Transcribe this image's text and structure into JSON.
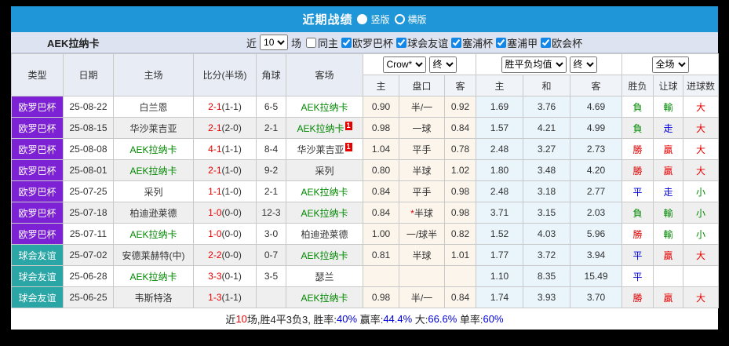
{
  "titlebar": {
    "title": "近期战绩",
    "options": [
      {
        "label": "竖版",
        "selected": true
      },
      {
        "label": "横版",
        "selected": false
      }
    ]
  },
  "filterbar": {
    "team": "AEK拉纳卡",
    "near_label": "近",
    "count_value": "10",
    "games_label": "场",
    "same_home_label": "同主",
    "same_home_checked": false,
    "leagues": [
      {
        "label": "欧罗巴杯",
        "checked": true
      },
      {
        "label": "球会友谊",
        "checked": true
      },
      {
        "label": "塞浦杯",
        "checked": true
      },
      {
        "label": "塞浦甲",
        "checked": true
      },
      {
        "label": "欧会杯",
        "checked": true
      }
    ]
  },
  "table": {
    "main_headers": [
      "类型",
      "日期",
      "主场",
      "比分(半场)",
      "角球",
      "客场"
    ],
    "selects": {
      "bookmaker": "Crow*",
      "bookmaker_stage": "终",
      "avg": "胜平负均值",
      "avg_stage": "终",
      "scope": "全场"
    },
    "sub_headers": [
      "主",
      "盘口",
      "客",
      "主",
      "和",
      "客",
      "胜负",
      "让球",
      "进球数"
    ],
    "rows": [
      {
        "type": "欧罗巴杯",
        "type_class": "purple",
        "date": "25-08-22",
        "home": "白兰恩",
        "home_class": "",
        "home_card": "",
        "score": "2-1",
        "half": "(1-1)",
        "corner": "6-5",
        "away": "AEK拉纳卡",
        "away_class": "green",
        "away_card": "",
        "crow_home": "0.90",
        "handicap": "半/一",
        "crow_away": "0.92",
        "avg_home": "1.69",
        "avg_draw": "3.76",
        "avg_away": "4.69",
        "result": "負",
        "result_class": "green",
        "let": "輸",
        "let_class": "green",
        "goal": "大",
        "goal_class": "red"
      },
      {
        "type": "欧罗巴杯",
        "type_class": "purple",
        "date": "25-08-15",
        "home": "华沙莱吉亚",
        "home_class": "",
        "home_card": "",
        "score": "2-1",
        "half": "(2-0)",
        "corner": "2-1",
        "away": "AEK拉纳卡",
        "away_class": "green",
        "away_card": "1",
        "crow_home": "0.98",
        "handicap": "一球",
        "crow_away": "0.84",
        "avg_home": "1.57",
        "avg_draw": "4.21",
        "avg_away": "4.99",
        "result": "負",
        "result_class": "green",
        "let": "走",
        "let_class": "blue",
        "goal": "大",
        "goal_class": "red"
      },
      {
        "type": "欧罗巴杯",
        "type_class": "purple",
        "date": "25-08-08",
        "home": "AEK拉纳卡",
        "home_class": "green",
        "home_card": "",
        "score": "4-1",
        "half": "(1-1)",
        "corner": "8-4",
        "away": "华沙莱吉亚",
        "away_class": "",
        "away_card": "1",
        "crow_home": "1.04",
        "handicap": "平手",
        "crow_away": "0.78",
        "avg_home": "2.48",
        "avg_draw": "3.27",
        "avg_away": "2.73",
        "result": "勝",
        "result_class": "red",
        "let": "贏",
        "let_class": "red",
        "goal": "大",
        "goal_class": "red"
      },
      {
        "type": "欧罗巴杯",
        "type_class": "purple",
        "date": "25-08-01",
        "home": "AEK拉纳卡",
        "home_class": "green",
        "home_card": "",
        "score": "2-1",
        "half": "(1-0)",
        "corner": "9-2",
        "away": "采列",
        "away_class": "",
        "away_card": "",
        "crow_home": "0.80",
        "handicap": "半球",
        "crow_away": "1.02",
        "avg_home": "1.80",
        "avg_draw": "3.48",
        "avg_away": "4.20",
        "result": "勝",
        "result_class": "red",
        "let": "贏",
        "let_class": "red",
        "goal": "大",
        "goal_class": "red"
      },
      {
        "type": "欧罗巴杯",
        "type_class": "purple",
        "date": "25-07-25",
        "home": "采列",
        "home_class": "",
        "home_card": "",
        "score": "1-1",
        "half": "(1-0)",
        "corner": "2-1",
        "away": "AEK拉纳卡",
        "away_class": "green",
        "away_card": "",
        "crow_home": "0.84",
        "handicap": "平手",
        "crow_away": "0.98",
        "avg_home": "2.48",
        "avg_draw": "3.18",
        "avg_away": "2.77",
        "result": "平",
        "result_class": "blue",
        "let": "走",
        "let_class": "blue",
        "goal": "小",
        "goal_class": "green"
      },
      {
        "type": "欧罗巴杯",
        "type_class": "purple",
        "date": "25-07-18",
        "home": "柏迪逊莱德",
        "home_class": "",
        "home_card": "",
        "score": "1-0",
        "half": "(0-0)",
        "corner": "12-3",
        "away": "AEK拉纳卡",
        "away_class": "green",
        "away_card": "",
        "crow_home": "0.84",
        "handicap": "*半球",
        "crow_away": "0.98",
        "avg_home": "3.71",
        "avg_draw": "3.15",
        "avg_away": "2.03",
        "result": "負",
        "result_class": "green",
        "let": "輸",
        "let_class": "green",
        "goal": "小",
        "goal_class": "green"
      },
      {
        "type": "欧罗巴杯",
        "type_class": "purple",
        "date": "25-07-11",
        "home": "AEK拉纳卡",
        "home_class": "green",
        "home_card": "",
        "score": "1-0",
        "half": "(0-0)",
        "corner": "3-0",
        "away": "柏迪逊莱德",
        "away_class": "",
        "away_card": "",
        "crow_home": "1.00",
        "handicap": "一/球半",
        "crow_away": "0.82",
        "avg_home": "1.52",
        "avg_draw": "4.03",
        "avg_away": "5.96",
        "result": "勝",
        "result_class": "red",
        "let": "輸",
        "let_class": "green",
        "goal": "小",
        "goal_class": "green"
      },
      {
        "type": "球会友谊",
        "type_class": "teal",
        "date": "25-07-02",
        "home": "安德莱赫特(中)",
        "home_class": "",
        "home_card": "",
        "score": "2-2",
        "half": "(0-0)",
        "corner": "0-7",
        "away": "AEK拉纳卡",
        "away_class": "green",
        "away_card": "",
        "crow_home": "0.81",
        "handicap": "半球",
        "crow_away": "1.01",
        "avg_home": "1.77",
        "avg_draw": "3.72",
        "avg_away": "3.94",
        "result": "平",
        "result_class": "blue",
        "let": "贏",
        "let_class": "red",
        "goal": "大",
        "goal_class": "red"
      },
      {
        "type": "球会友谊",
        "type_class": "teal",
        "date": "25-06-28",
        "home": "AEK拉纳卡",
        "home_class": "green",
        "home_card": "",
        "score": "3-3",
        "half": "(0-1)",
        "corner": "3-5",
        "away": "瑟兰",
        "away_class": "",
        "away_card": "",
        "crow_home": "",
        "handicap": "",
        "crow_away": "",
        "avg_home": "1.10",
        "avg_draw": "8.35",
        "avg_away": "15.49",
        "result": "平",
        "result_class": "blue",
        "let": "",
        "let_class": "",
        "goal": "",
        "goal_class": ""
      },
      {
        "type": "球会友谊",
        "type_class": "teal",
        "date": "25-06-25",
        "home": "韦斯特洛",
        "home_class": "",
        "home_card": "",
        "score": "1-3",
        "half": "(1-1)",
        "corner": "",
        "away": "AEK拉纳卡",
        "away_class": "green",
        "away_card": "",
        "crow_home": "0.98",
        "handicap": "半/一",
        "crow_away": "0.84",
        "avg_home": "1.74",
        "avg_draw": "3.93",
        "avg_away": "3.70",
        "result": "勝",
        "result_class": "red",
        "let": "贏",
        "let_class": "red",
        "goal": "大",
        "goal_class": "red"
      }
    ]
  },
  "footer": {
    "segments": [
      {
        "text": "近",
        "class": ""
      },
      {
        "text": "10",
        "class": "red"
      },
      {
        "text": "场,胜4平3负3, 胜率:",
        "class": ""
      },
      {
        "text": "40%",
        "class": "blue"
      },
      {
        "text": " 赢率:",
        "class": ""
      },
      {
        "text": "44.4%",
        "class": "blue"
      },
      {
        "text": " 大:",
        "class": ""
      },
      {
        "text": "66.6%",
        "class": "blue"
      },
      {
        "text": " 单率:",
        "class": ""
      },
      {
        "text": "60%",
        "class": "blue"
      }
    ]
  },
  "colors": {
    "titlebar_blue": "#1E96D8",
    "filterbar_bg": "#DDE3F0",
    "europa_purple": "#7D21D4",
    "friendly_teal": "#2AA6A6",
    "win_red": "#e60000",
    "lose_green": "#008800",
    "draw_blue": "#0000dd",
    "crow_cell_bg": "#fcf5ec",
    "avg_cell_bg": "#e9f4fb"
  }
}
